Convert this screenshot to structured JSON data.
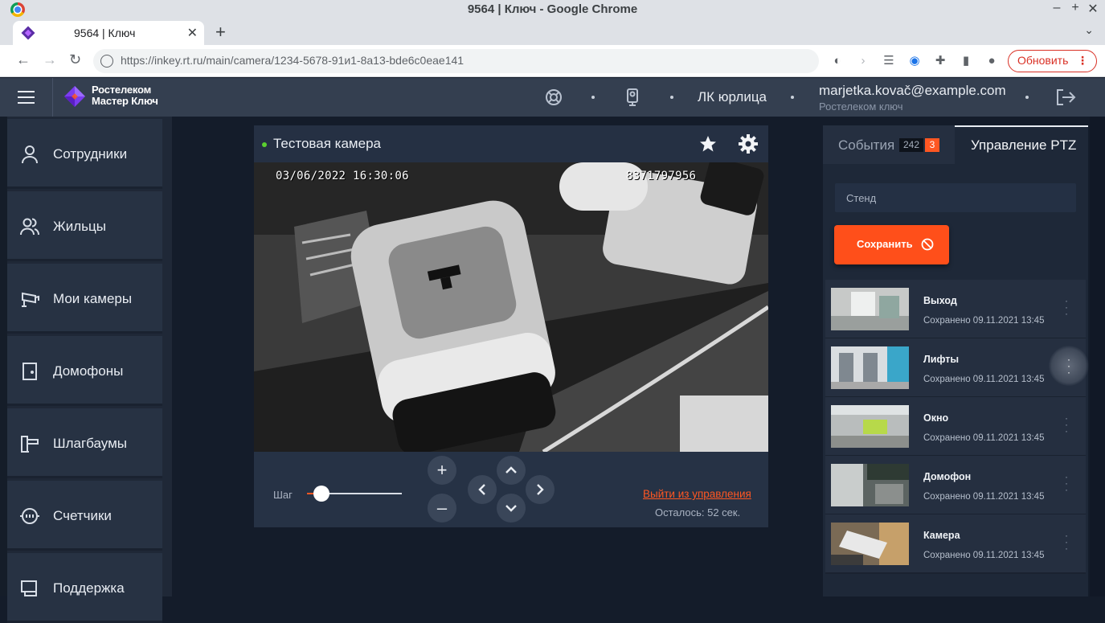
{
  "browser": {
    "window_title": "9564 | Ключ - Google Chrome",
    "tab_title": "9564 | Ключ",
    "url": "https://inkey.rt.ru/main/camera/1234-5678-91и1-8a13-bde6c0eae141",
    "update_label": "Обновить"
  },
  "header": {
    "logo_line1": "Ростелеком",
    "logo_line2": "Мастер Ключ",
    "role": "ЛК юрлица",
    "email": "marjetka.kovač@example.com",
    "company": "Ростелеком ключ"
  },
  "sidebar": {
    "items": [
      {
        "label": "Сотрудники",
        "icon": "person-icon"
      },
      {
        "label": "Жильцы",
        "icon": "people-icon"
      },
      {
        "label": "Мои камеры",
        "icon": "camera-icon"
      },
      {
        "label": "Домофоны",
        "icon": "door-icon"
      },
      {
        "label": "Шлагбаумы",
        "icon": "barrier-icon"
      },
      {
        "label": "Счетчики",
        "icon": "meter-icon"
      },
      {
        "label": "Поддержка",
        "icon": "support-icon"
      }
    ]
  },
  "camera": {
    "title": "Тестовая камера",
    "osd_datetime": "03/06/2022 16:30:06",
    "osd_id": "8371797956",
    "step_label": "Шаг",
    "step_value": 0.1,
    "exit_label": "Выйти из управления",
    "remaining": "Осталось: 52 сек."
  },
  "right_panel": {
    "tab_events": "События",
    "events_total": "242",
    "events_new": "3",
    "tab_ptz": "Управление PTZ",
    "preset_name_value": "Стенд",
    "save_label": "Сохранить",
    "presets": [
      {
        "name": "Выход",
        "saved": "Сохранено 09.11.2021 13:45"
      },
      {
        "name": "Лифты",
        "saved": "Сохранено 09.11.2021 13:45"
      },
      {
        "name": "Окно",
        "saved": "Сохранено 09.11.2021 13:45"
      },
      {
        "name": "Домофон",
        "saved": "Сохранено 09.11.2021 13:45"
      },
      {
        "name": "Камера",
        "saved": "Сохранено 09.11.2021 13:45"
      }
    ]
  },
  "colors": {
    "accent": "#ff5722",
    "header_bg": "#343f50",
    "page_bg": "#141c2a",
    "live_indicator": "#5bd02f"
  }
}
